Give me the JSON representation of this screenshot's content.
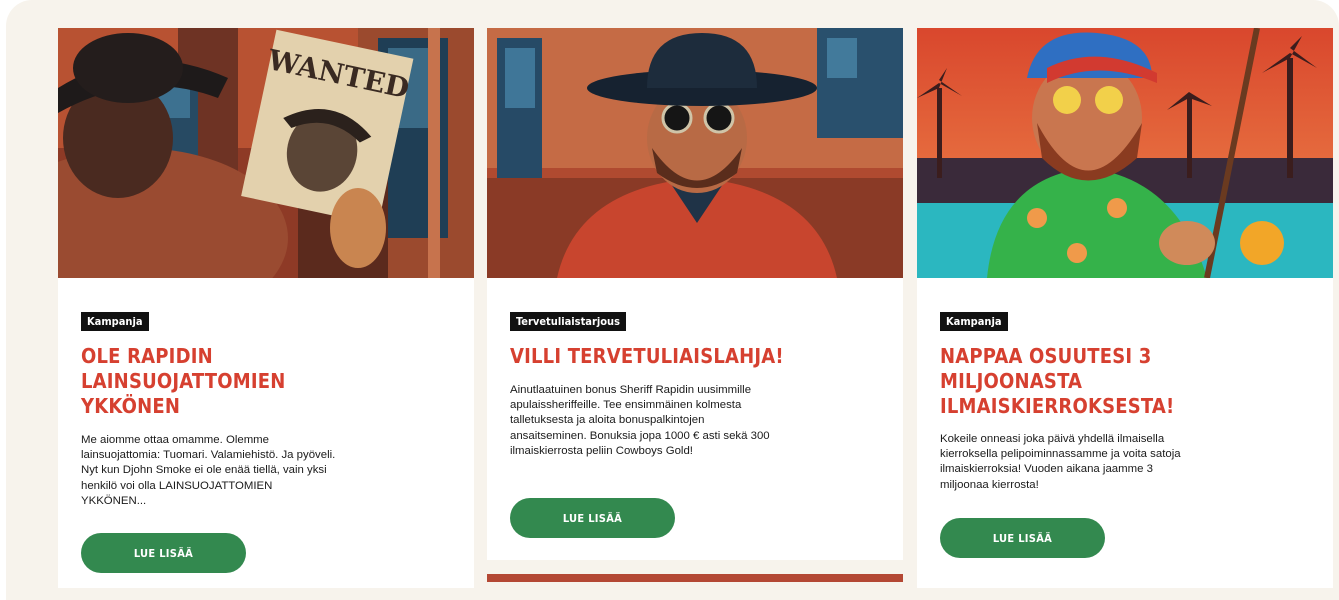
{
  "cards": [
    {
      "tag": "Kampanja",
      "title": "OLE RAPIDIN LAINSUOJATTOMIEN YKKÖNEN",
      "description": "Me aiomme ottaa omamme. Olemme lainsuojattomia: Tuomari. Valamiehistö. Ja pyöveli. Nyt kun Djohn Smoke ei ole enää tiellä, vain yksi henkilö voi olla LAINSUOJATTOMIEN YKKÖNEN...",
      "button": "LUE LISÄÄ",
      "poster_text": "WANTED"
    },
    {
      "tag": "Tervetuliaistarjous",
      "title": "VILLI TERVETULIAISLAHJA!",
      "description": "Ainutlaatuinen bonus Sheriff Rapidin uusimmille apulaissheriffeille. Tee ensimmäinen kolmesta talletuksesta ja aloita bonuspalkintojen ansaitseminen. Bonuksia jopa 1000 € asti sekä 300 ilmaiskierrosta peliin Cowboys Gold!",
      "button": "LUE LISÄÄ"
    },
    {
      "tag": "Kampanja",
      "title": "NAPPAA OSUUTESI 3 MILJOONASTA ILMAISKIERROKSESTA!",
      "description": "Kokeile onneasi joka päivä yhdellä ilmaisella kierroksella pelipoiminnassamme ja voita satoja ilmaiskierroksia! Vuoden aikana jaamme 3 miljoonaa kierrosta!",
      "button": "LUE LISÄÄ"
    }
  ],
  "colors": {
    "accent_title": "#d64030",
    "button_bg": "#33894f",
    "tag_bg": "#111111",
    "frame_bg": "#f7f3ec"
  }
}
